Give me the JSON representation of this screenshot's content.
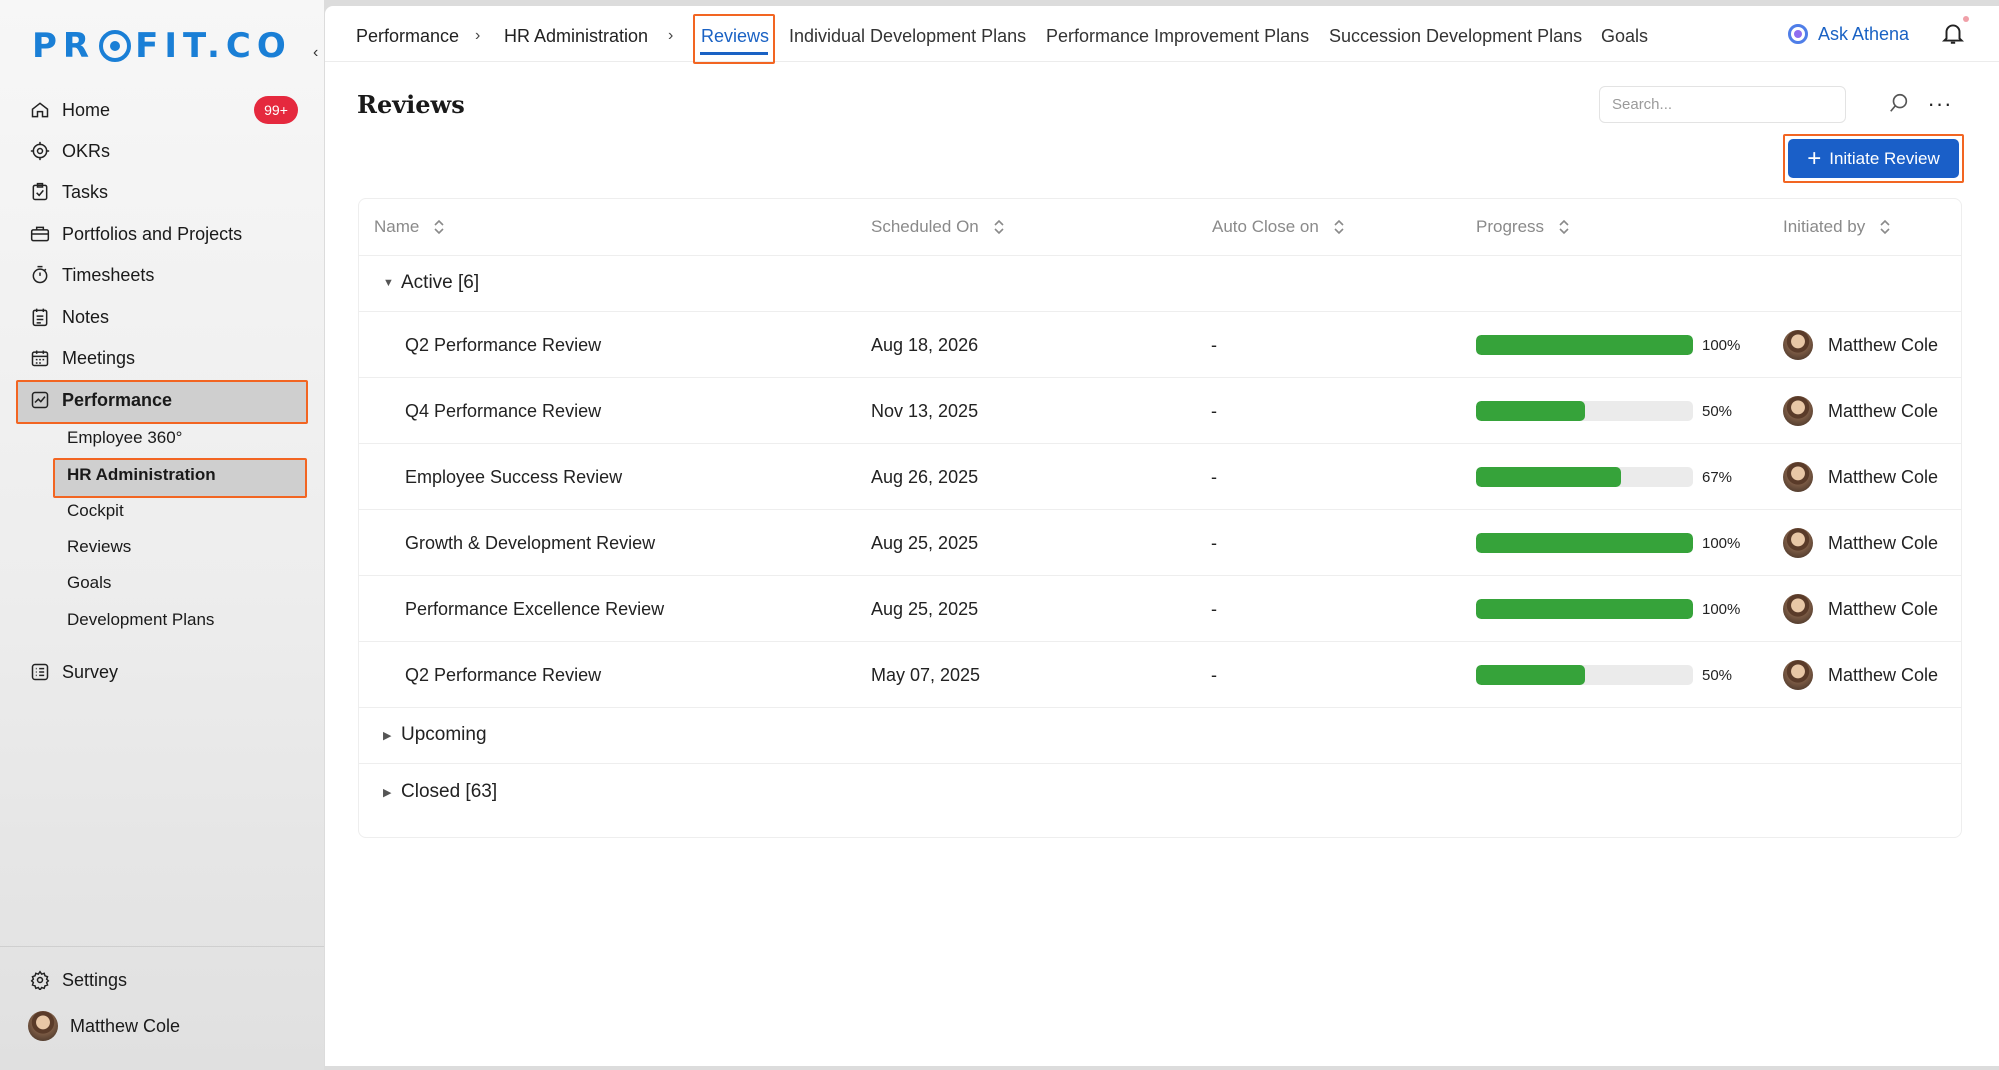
{
  "brand": {
    "logo_pre": "PR",
    "logo_post": "FIT.CO"
  },
  "sidebar": {
    "items": [
      {
        "label": "Home",
        "icon": "home-icon"
      },
      {
        "label": "OKRs",
        "icon": "target-icon"
      },
      {
        "label": "Tasks",
        "icon": "tasks-icon"
      },
      {
        "label": "Portfolios and Projects",
        "icon": "briefcase-icon"
      },
      {
        "label": "Timesheets",
        "icon": "stopwatch-icon"
      },
      {
        "label": "Notes",
        "icon": "notes-icon"
      },
      {
        "label": "Meetings",
        "icon": "calendar-icon"
      },
      {
        "label": "Performance",
        "icon": "chart-icon"
      },
      {
        "label": "Survey",
        "icon": "survey-icon"
      }
    ],
    "home_badge": "99+",
    "performance_sub": [
      "Employee 360°",
      "HR Administration",
      "Cockpit",
      "Reviews",
      "Goals",
      "Development Plans"
    ],
    "settings_label": "Settings",
    "user_name": "Matthew Cole"
  },
  "topnav": {
    "breadcrumb": [
      "Performance",
      "HR Administration"
    ],
    "separator": "›",
    "tabs": [
      "Reviews",
      "Individual Development Plans",
      "Performance Improvement Plans",
      "Succession Development Plans",
      "Goals"
    ],
    "active_tab": "Reviews",
    "ask_athena": "Ask Athena"
  },
  "page": {
    "title": "Reviews",
    "search_placeholder": "Search...",
    "more": "···",
    "initiate_button": "Initiate Review"
  },
  "table": {
    "columns": [
      "Name",
      "Scheduled On",
      "Auto Close on",
      "Progress",
      "Initiated by"
    ],
    "groups": {
      "active": "Active  [6]",
      "upcoming": "Upcoming",
      "closed": "Closed  [63]"
    },
    "rows": [
      {
        "name": "Q2 Performance Review",
        "scheduled": "Aug 18, 2026",
        "auto_close": "-",
        "progress": 100,
        "progress_label": "100%",
        "initiated_by": "Matthew Cole"
      },
      {
        "name": "Q4 Performance Review",
        "scheduled": "Nov 13, 2025",
        "auto_close": "-",
        "progress": 50,
        "progress_label": "50%",
        "initiated_by": "Matthew Cole"
      },
      {
        "name": "Employee Success Review",
        "scheduled": "Aug 26, 2025",
        "auto_close": "-",
        "progress": 67,
        "progress_label": "67%",
        "initiated_by": "Matthew Cole"
      },
      {
        "name": "Growth & Development Review",
        "scheduled": "Aug 25, 2025",
        "auto_close": "-",
        "progress": 100,
        "progress_label": "100%",
        "initiated_by": "Matthew Cole"
      },
      {
        "name": "Performance Excellence Review",
        "scheduled": "Aug 25, 2025",
        "auto_close": "-",
        "progress": 100,
        "progress_label": "100%",
        "initiated_by": "Matthew Cole"
      },
      {
        "name": "Q2 Performance Review",
        "scheduled": "May 07, 2025",
        "auto_close": "-",
        "progress": 50,
        "progress_label": "50%",
        "initiated_by": "Matthew Cole"
      }
    ]
  },
  "colors": {
    "accent": "#1a62c4",
    "progress": "#36a33a",
    "highlight": "#f26522",
    "badge": "#e5293e"
  }
}
